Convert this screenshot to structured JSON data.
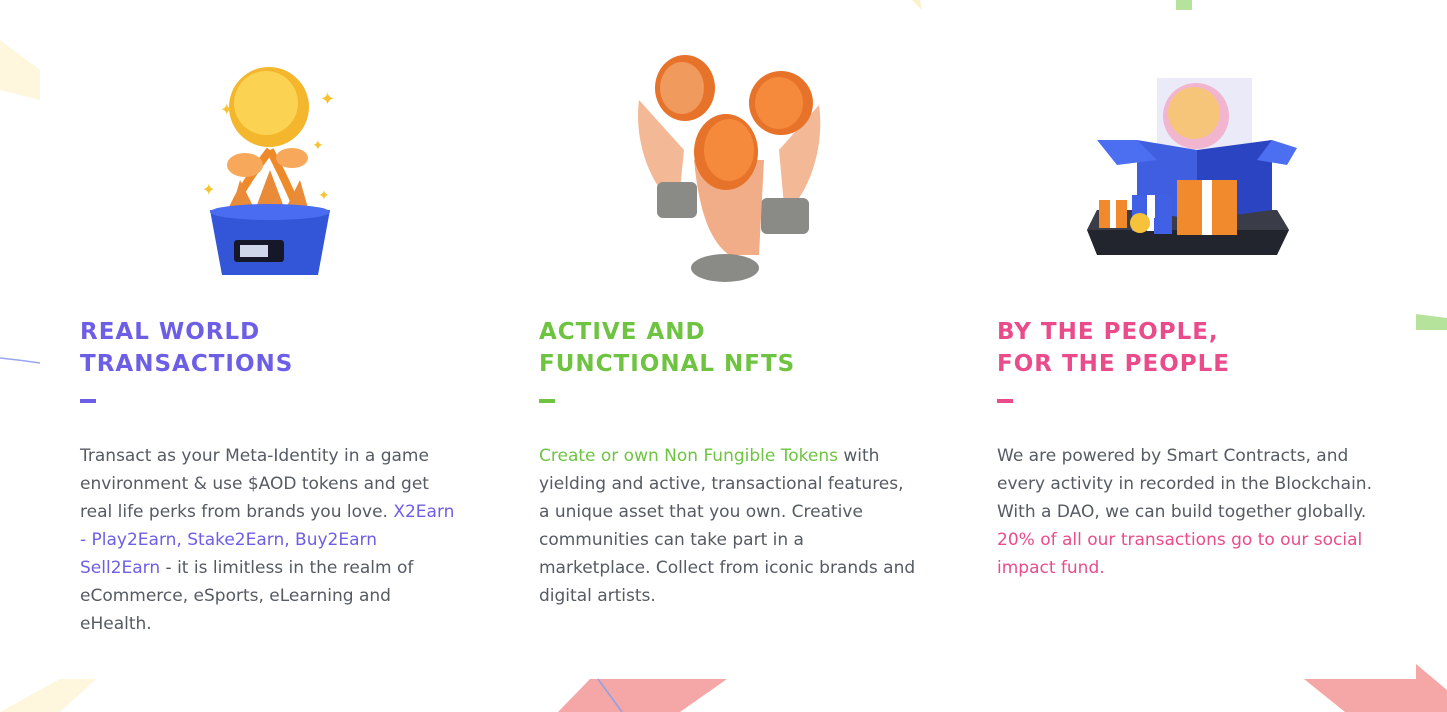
{
  "colors": {
    "purple": "#6d5ee6",
    "green": "#6ec440",
    "pink": "#ea4c8b",
    "text": "#555a63"
  },
  "features": [
    {
      "icon": "money-plant-icon",
      "title_line1": "REAL WORLD",
      "title_line2": "TRANSACTIONS",
      "text_a": "Transact as your Meta-Identity in a game environment & use $AOD tokens and get real life perks from brands you love.",
      "link": "X2Earn - Play2Earn, Stake2Earn, Buy2Earn Sell2Earn",
      "text_b": "- it is limitless in the realm of eCommerce, eSports, eLearning and eHealth."
    },
    {
      "icon": "hands-coins-icon",
      "title_line1": "ACTIVE AND",
      "title_line2": "FUNCTIONAL NFTS",
      "link": "Create or own Non Fungible Tokens",
      "text_b": "with yielding and active, transactional features, a unique asset that you own. Creative communities can take part in a marketplace. Collect from iconic brands and digital artists."
    },
    {
      "icon": "gift-box-coin-icon",
      "title_line1": "BY THE PEOPLE,",
      "title_line2": "FOR THE PEOPLE",
      "text_a": "We are powered by Smart Contracts, and every activity in recorded in the Blockchain. With a DAO, we can build together globally.",
      "link": "20% of all our transactions go to our social impact fund."
    }
  ]
}
